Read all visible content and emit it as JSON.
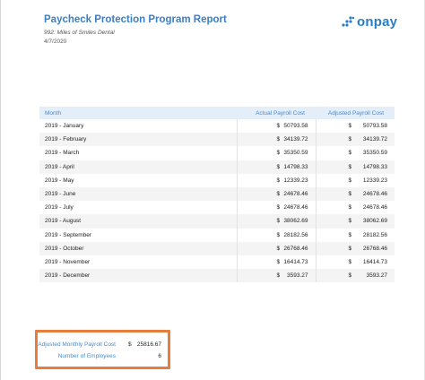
{
  "report": {
    "title": "Paycheck Protection Program Report",
    "business": "992: Miles of Smiles Dental",
    "date": "4/7/2020",
    "brand": "onpay",
    "brand_color": "#2a7ec6"
  },
  "table": {
    "headers": {
      "month": "Month",
      "actual": "Actual Payroll Cost",
      "adjusted": "Adjusted Payroll Cost"
    },
    "currency": "$",
    "rows": [
      {
        "month": "2019 - January",
        "actual": "50793.58",
        "adjusted": "50793.58"
      },
      {
        "month": "2019 - February",
        "actual": "34139.72",
        "adjusted": "34139.72"
      },
      {
        "month": "2019 - March",
        "actual": "35350.59",
        "adjusted": "35350.59"
      },
      {
        "month": "2019 - April",
        "actual": "14798.33",
        "adjusted": "14798.33"
      },
      {
        "month": "2019 - May",
        "actual": "12339.23",
        "adjusted": "12339.23"
      },
      {
        "month": "2019 - June",
        "actual": "24678.46",
        "adjusted": "24678.46"
      },
      {
        "month": "2019 - July",
        "actual": "24678.46",
        "adjusted": "24678.46"
      },
      {
        "month": "2019 - August",
        "actual": "38062.69",
        "adjusted": "38062.69"
      },
      {
        "month": "2019 - September",
        "actual": "28182.56",
        "adjusted": "28182.56"
      },
      {
        "month": "2019 - October",
        "actual": "26768.46",
        "adjusted": "26768.46"
      },
      {
        "month": "2019 - November",
        "actual": "16414.73",
        "adjusted": "16414.73"
      },
      {
        "month": "2019 - December",
        "actual": "3593.27",
        "adjusted": "3593.27"
      }
    ]
  },
  "summary": {
    "adjusted_label": "Adjusted Monthly Payroll Cost",
    "adjusted_currency": "$",
    "adjusted_value": "25816.67",
    "employees_label": "Number of Employees",
    "employees_value": "6",
    "highlight_color": "#e77d3c"
  }
}
